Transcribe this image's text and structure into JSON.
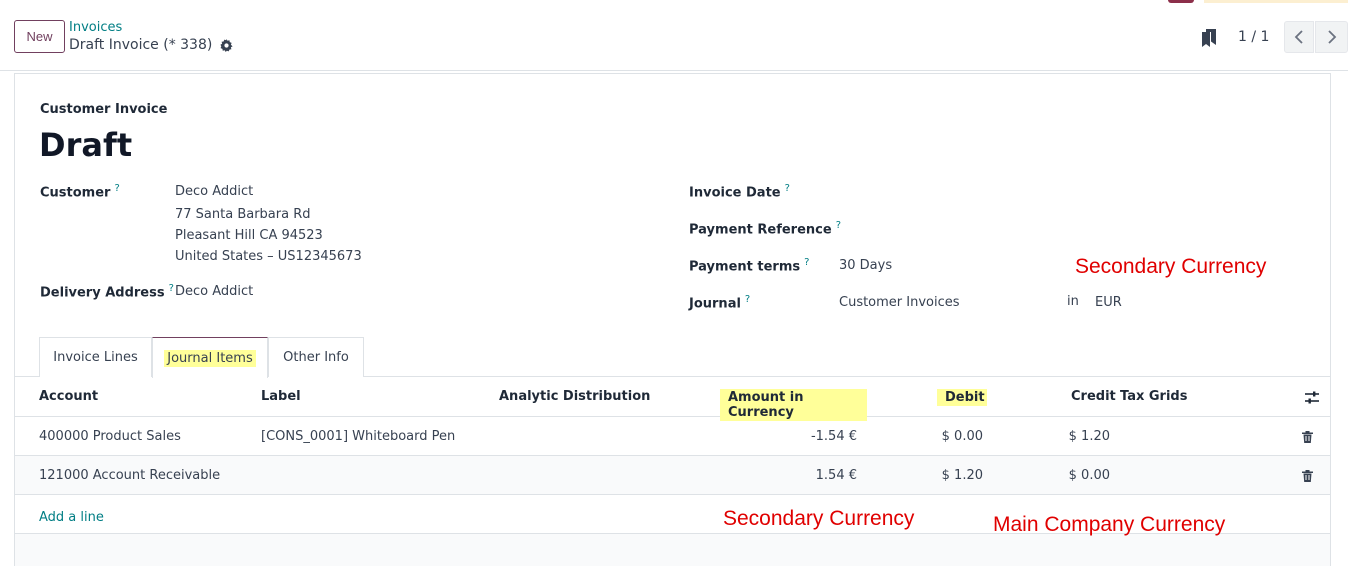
{
  "control_panel": {
    "new_label": "New",
    "breadcrumb": "Invoices",
    "record_name": "Draft Invoice (* 338)",
    "pager_value": "1 / 1"
  },
  "form": {
    "doc_type": "Customer Invoice",
    "title": "Draft",
    "customer": {
      "label": "Customer",
      "name": "Deco Addict",
      "street": "77 Santa Barbara Rd",
      "city": "Pleasant Hill CA 94523",
      "country": "United States – US12345673"
    },
    "delivery_address": {
      "label": "Delivery Address",
      "value": "Deco Addict"
    },
    "invoice_date": {
      "label": "Invoice Date",
      "value": ""
    },
    "payment_reference": {
      "label": "Payment Reference",
      "value": ""
    },
    "payment_terms": {
      "label": "Payment terms",
      "value": "30 Days"
    },
    "journal": {
      "label": "Journal",
      "value": "Customer Invoices",
      "in_label": "in",
      "currency": "EUR"
    },
    "help_mark": "?"
  },
  "tabs": [
    {
      "label": "Invoice Lines",
      "active": false
    },
    {
      "label": "Journal Items",
      "active": true,
      "highlighted": true
    },
    {
      "label": "Other Info",
      "active": false
    }
  ],
  "journal_items": {
    "columns": [
      "Account",
      "Label",
      "Analytic Distribution",
      "Amount in Currency",
      "Debit",
      "Credit",
      "Tax Grids"
    ],
    "rows": [
      {
        "account": "400000 Product Sales",
        "label": "[CONS_0001] Whiteboard Pen",
        "analytic": "",
        "amount_currency": "-1.54 €",
        "debit": "$ 0.00",
        "credit": "$ 1.20",
        "tax_grids": ""
      },
      {
        "account": "121000 Account Receivable",
        "label": "",
        "analytic": "",
        "amount_currency": "1.54 €",
        "debit": "$ 1.20",
        "credit": "$ 0.00",
        "tax_grids": ""
      }
    ],
    "add_line": "Add a line"
  },
  "annotations": {
    "secondary_currency_top": "Secondary Currency",
    "secondary_currency_bottom": "Secondary Currency",
    "main_company_currency": "Main Company Currency",
    "color": "#e00000"
  },
  "colors": {
    "brand": "#71405f",
    "link": "#017e84",
    "highlight": "#ffff99"
  }
}
